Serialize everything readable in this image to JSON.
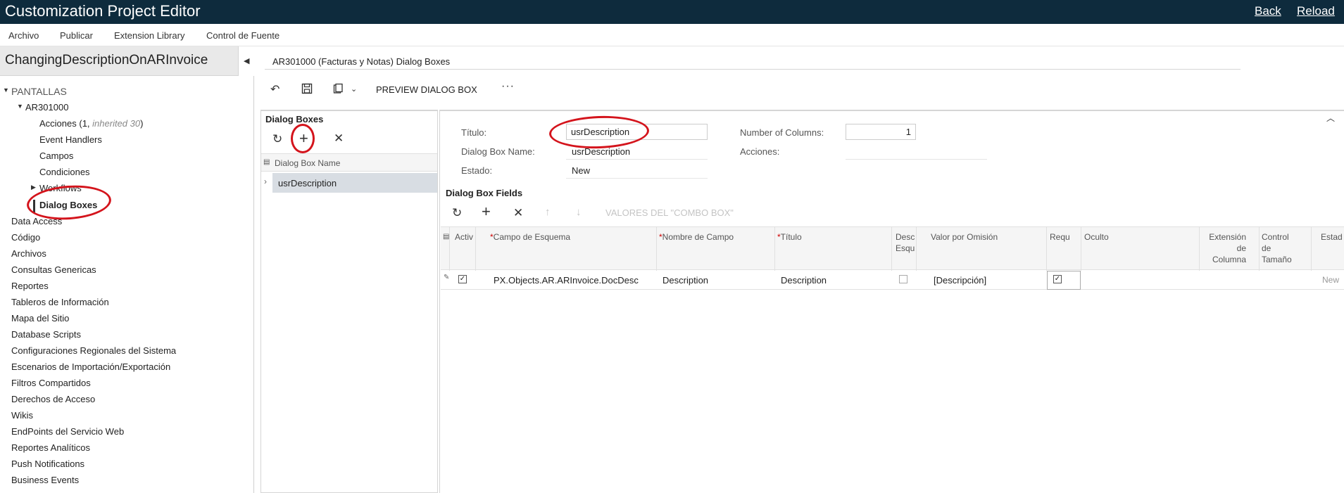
{
  "app": {
    "title": "Customization Project Editor",
    "back_label": "Back",
    "reload_label": "Reload"
  },
  "menu": [
    "Archivo",
    "Publicar",
    "Extension Library",
    "Control de Fuente"
  ],
  "project": {
    "name": "ChangingDescriptionOnARInvoice"
  },
  "tree": {
    "root": "PANTALLAS",
    "screen": "AR301000",
    "acciones_label": "Acciones (1, ",
    "acciones_inherited": "inherited 30",
    "acciones_end": ")",
    "children": [
      "Event Handlers",
      "Campos",
      "Condiciones",
      "Workflows",
      "Dialog Boxes"
    ],
    "sections": [
      "Data Access",
      "Código",
      "Archivos",
      "Consultas Genericas",
      "Reportes",
      "Tableros de Información",
      "Mapa del Sitio",
      "Database Scripts",
      "Configuraciones Regionales del Sistema",
      "Escenarios de Importación/Exportación",
      "Filtros Compartidos",
      "Derechos de Acceso",
      "Wikis",
      "EndPoints del Servicio Web",
      "Reportes Analíticos",
      "Push Notifications",
      "Business Events"
    ]
  },
  "breadcrumb": "AR301000 (Facturas y Notas) Dialog Boxes",
  "toolbar": {
    "undo_icon": "undo-icon",
    "save_icon": "save-icon",
    "clipboard_icon": "clipboard-icon",
    "preview_label": "PREVIEW DIALOG BOX",
    "more_label": "···"
  },
  "dialog_boxes": {
    "title": "Dialog Boxes",
    "column": "Dialog Box Name",
    "rows": [
      "usrDescription"
    ]
  },
  "form": {
    "titulo_label": "Título:",
    "titulo_value": "usrDescription",
    "name_label": "Dialog Box Name:",
    "name_value": "usrDescription",
    "estado_label": "Estado:",
    "estado_value": "New",
    "columns_label": "Number of Columns:",
    "columns_value": "1",
    "acciones_label": "Acciones:"
  },
  "fields": {
    "title": "Dialog Box Fields",
    "combo_label": "VALORES DEL \"COMBO BOX\"",
    "headers": {
      "activo": "Activ",
      "campo": "Campo de Esquema",
      "nombre": "Nombre de Campo",
      "titulo": "Título",
      "desc1": "Desc",
      "desc2": "Esqu",
      "valor": "Valor por Omisión",
      "req": "Requ",
      "oculto": "Oculto",
      "ext1": "Extensión",
      "ext2": "de",
      "ext3": "Columna",
      "ctrl1": "Control",
      "ctrl2": "de",
      "ctrl3": "Tamaño",
      "estado": "Estad"
    },
    "row": {
      "campo": "PX.Objects.AR.ARInvoice.DocDesc",
      "nombre": "Description",
      "titulo": "Description",
      "valor": "[Descripción]",
      "estado": "New"
    }
  },
  "colors": {
    "topbar": "#0e2b3d",
    "annotation": "#d4141c",
    "selected_row": "#d8dde3"
  }
}
